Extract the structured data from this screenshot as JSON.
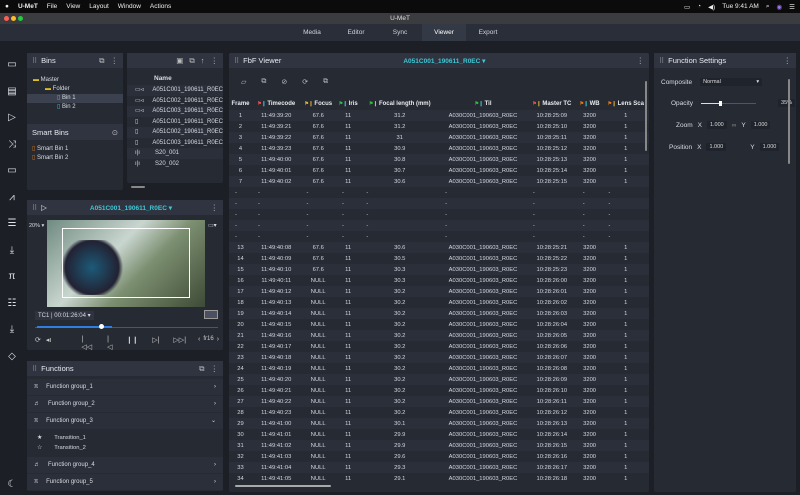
{
  "menubar": {
    "app": "U-MeT",
    "items": [
      "File",
      "View",
      "Layout",
      "Window",
      "Actions"
    ],
    "clock": "Tue 9:41 AM"
  },
  "window": {
    "title": "U-MeT"
  },
  "tabs": [
    {
      "label": "Media"
    },
    {
      "label": "Editor"
    },
    {
      "label": "Sync"
    },
    {
      "label": "Viewer",
      "active": true
    },
    {
      "label": "Export"
    }
  ],
  "rail_icons": [
    "folder-icon",
    "briefcase-icon",
    "play-icon",
    "shuffle-icon",
    "clip-icon",
    "chart-icon",
    "list-icon",
    "download-icon",
    "pi-icon",
    "checklist-icon",
    "import-icon",
    "shape-icon",
    "moon-icon"
  ],
  "bins": {
    "title": "Bins",
    "tree": [
      {
        "label": "Master",
        "level": 0
      },
      {
        "label": "Folder",
        "level": 1
      },
      {
        "label": "Bin 1",
        "level": 2,
        "selected": true
      },
      {
        "label": "Bin 2",
        "level": 2
      }
    ],
    "smart_title": "Smart Bins",
    "smart": [
      "Smart Bin 1",
      "Smart Bin 2"
    ]
  },
  "media": {
    "column": "Name",
    "items": [
      {
        "icon": "video-icon",
        "name": "A051C001_190611_R0EC"
      },
      {
        "icon": "video-icon",
        "name": "A051C002_190611_R0EC"
      },
      {
        "icon": "video-icon",
        "name": "A051C003_190611_R0EC"
      },
      {
        "icon": "file-icon",
        "name": "A051C001_190611_R0EC"
      },
      {
        "icon": "file-icon",
        "name": "A051C002_190611_R0EC"
      },
      {
        "icon": "file-icon",
        "name": "A051C003_190611_R0EC"
      },
      {
        "icon": "audio-icon",
        "name": "S20_001"
      },
      {
        "icon": "audio-icon",
        "name": "S20_002"
      }
    ]
  },
  "viewer": {
    "clip": "A051C001_190611_R0EC",
    "zoom": "20%",
    "tc_label": "TC1",
    "timecode": "00:01:26:04",
    "frame": "fr16",
    "playhead": 0.35
  },
  "functions": {
    "title": "Functions",
    "groups": [
      {
        "label": "Function group_1",
        "open": false
      },
      {
        "label": "Function group_2",
        "open": false
      },
      {
        "label": "Function group_3",
        "open": true,
        "children": [
          "Transition_1",
          "Transition_2"
        ]
      },
      {
        "label": "Function group_4",
        "open": false
      },
      {
        "label": "Function group_5",
        "open": false
      }
    ]
  },
  "fbf": {
    "title": "FbF Viewer",
    "clip": "A051C001_190611_R0EC",
    "columns": [
      {
        "label": "Frame"
      },
      {
        "label": "Timecode",
        "color": "#e05050"
      },
      {
        "label": "Focus",
        "color": "#e0b030"
      },
      {
        "label": "Iris",
        "color": "#30c040"
      },
      {
        "label": "Focal length (mm)",
        "color": "#30c040"
      },
      {
        "label": "Til",
        "color": "#30c040"
      },
      {
        "label": "Master TC",
        "color": "#e05050"
      },
      {
        "label": "WB",
        "color": "#e07a20"
      },
      {
        "label": "Lens Sca",
        "color": "#e07a20"
      }
    ],
    "rows": [
      [
        "1",
        "11:49:39:20",
        "67.6",
        "11",
        "31.2",
        "A030C001_190603_R0EC",
        "10:28:25:09",
        "3200",
        "1"
      ],
      [
        "2",
        "11:49:39:21",
        "67.6",
        "11",
        "31.2",
        "A030C001_190603_R0EC",
        "10:28:25:10",
        "3200",
        "1"
      ],
      [
        "3",
        "11:49:39:22",
        "67.6",
        "11",
        "31",
        "A030C001_190603_R0EC",
        "10:28:25:11",
        "3200",
        "1"
      ],
      [
        "4",
        "11:49:39:23",
        "67.6",
        "11",
        "30.9",
        "A030C001_190603_R0EC",
        "10:28:25:12",
        "3200",
        "1"
      ],
      [
        "5",
        "11:49:40:00",
        "67.6",
        "11",
        "30.8",
        "A030C001_190603_R0EC",
        "10:28:25:13",
        "3200",
        "1"
      ],
      [
        "6",
        "11:49:40:01",
        "67.6",
        "11",
        "30.7",
        "A030C001_190603_R0EC",
        "10:28:25:14",
        "3200",
        "1"
      ],
      [
        "7",
        "11:49:40:02",
        "67.6",
        "11",
        "30.6",
        "A030C001_190603_R0EC",
        "10:28:25:15",
        "3200",
        "1"
      ],
      [
        "-",
        "-",
        "-",
        "-",
        "-",
        "-",
        "-",
        "-",
        "-"
      ],
      [
        "-",
        "-",
        "-",
        "-",
        "-",
        "-",
        "-",
        "-",
        "-"
      ],
      [
        "-",
        "-",
        "-",
        "-",
        "-",
        "-",
        "-",
        "-",
        "-"
      ],
      [
        "-",
        "-",
        "-",
        "-",
        "-",
        "-",
        "-",
        "-",
        "-"
      ],
      [
        "-",
        "-",
        "-",
        "-",
        "-",
        "-",
        "-",
        "-",
        "-"
      ],
      [
        "13",
        "11:49:40:08",
        "67.6",
        "11",
        "30.6",
        "A030C001_190603_R0EC",
        "10:28:25:21",
        "3200",
        "1"
      ],
      [
        "14",
        "11:49:40:09",
        "67.6",
        "11",
        "30.5",
        "A030C001_190603_R0EC",
        "10:28:25:22",
        "3200",
        "1"
      ],
      [
        "15",
        "11:49:40:10",
        "67.6",
        "11",
        "30.3",
        "A030C001_190603_R0EC",
        "10:28:25:23",
        "3200",
        "1"
      ],
      [
        "16",
        "11:49:40:11",
        "NULL",
        "11",
        "30.3",
        "A030C001_190603_R0EC",
        "10:28:26:00",
        "3200",
        "1"
      ],
      [
        "17",
        "11:49:40:12",
        "NULL",
        "11",
        "30.2",
        "A030C001_190603_R0EC",
        "10:28:26:01",
        "3200",
        "1"
      ],
      [
        "18",
        "11:49:40:13",
        "NULL",
        "11",
        "30.2",
        "A030C001_190603_R0EC",
        "10:28:26:02",
        "3200",
        "1"
      ],
      [
        "19",
        "11:49:40:14",
        "NULL",
        "11",
        "30.2",
        "A030C001_190603_R0EC",
        "10:28:26:03",
        "3200",
        "1"
      ],
      [
        "20",
        "11:49:40:15",
        "NULL",
        "11",
        "30.2",
        "A030C001_190603_R0EC",
        "10:28:26:04",
        "3200",
        "1"
      ],
      [
        "21",
        "11:49:40:16",
        "NULL",
        "11",
        "30.2",
        "A030C001_190603_R0EC",
        "10:28:26:05",
        "3200",
        "1"
      ],
      [
        "22",
        "11:49:40:17",
        "NULL",
        "11",
        "30.2",
        "A030C001_190603_R0EC",
        "10:28:26:06",
        "3200",
        "1"
      ],
      [
        "23",
        "11:49:40:18",
        "NULL",
        "11",
        "30.2",
        "A030C001_190603_R0EC",
        "10:28:26:07",
        "3200",
        "1"
      ],
      [
        "24",
        "11:49:40:19",
        "NULL",
        "11",
        "30.2",
        "A030C001_190603_R0EC",
        "10:28:26:08",
        "3200",
        "1"
      ],
      [
        "25",
        "11:49:40:20",
        "NULL",
        "11",
        "30.2",
        "A030C001_190603_R0EC",
        "10:28:26:09",
        "3200",
        "1"
      ],
      [
        "26",
        "11:49:40:21",
        "NULL",
        "11",
        "30.2",
        "A030C001_190603_R0EC",
        "10:28:26:10",
        "3200",
        "1"
      ],
      [
        "27",
        "11:49:40:22",
        "NULL",
        "11",
        "30.2",
        "A030C001_190603_R0EC",
        "10:28:26:11",
        "3200",
        "1"
      ],
      [
        "28",
        "11:49:40:23",
        "NULL",
        "11",
        "30.2",
        "A030C001_190603_R0EC",
        "10:28:26:12",
        "3200",
        "1"
      ],
      [
        "29",
        "11:49:41:00",
        "NULL",
        "11",
        "30.1",
        "A030C001_190603_R0EC",
        "10:28:26:13",
        "3200",
        "1"
      ],
      [
        "30",
        "11:49:41:01",
        "NULL",
        "11",
        "29.9",
        "A030C001_190603_R0EC",
        "10:28:26:14",
        "3200",
        "1"
      ],
      [
        "31",
        "11:49:41:02",
        "NULL",
        "11",
        "29.9",
        "A030C001_190603_R0EC",
        "10:28:26:15",
        "3200",
        "1"
      ],
      [
        "32",
        "11:49:41:03",
        "NULL",
        "11",
        "29.6",
        "A030C001_190603_R0EC",
        "10:28:26:16",
        "3200",
        "1"
      ],
      [
        "33",
        "11:49:41:04",
        "NULL",
        "11",
        "29.3",
        "A030C001_190603_R0EC",
        "10:28:26:17",
        "3200",
        "1"
      ],
      [
        "34",
        "11:49:41:05",
        "NULL",
        "11",
        "29.1",
        "A030C001_190603_R0EC",
        "10:28:26:18",
        "3200",
        "1"
      ]
    ]
  },
  "settings": {
    "title": "Function Settings",
    "composite_label": "Composite",
    "composite_value": "Normal",
    "opacity_label": "Opacity",
    "opacity": "35%",
    "opacity_fraction": 0.35,
    "zoom_label": "Zoom",
    "position_label": "Position",
    "x_label": "X",
    "y_label": "Y",
    "zoom_x": "1.000",
    "zoom_y": "1.000",
    "pos_x": "1.000",
    "pos_y": "1.000"
  },
  "colors": {
    "accent": "#3fc7d6",
    "playhead": "#2f7fe0",
    "folder": "#e0c020",
    "smartbin": "#e07a20"
  }
}
